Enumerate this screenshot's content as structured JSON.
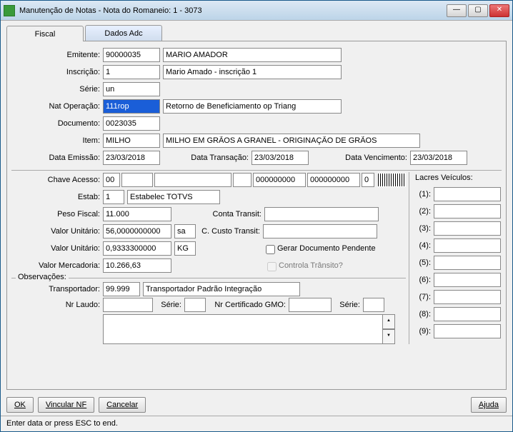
{
  "window": {
    "title": "Manutenção de Notas - Nota do Romaneio: 1 - 3073"
  },
  "tabs": {
    "fiscal": "Fiscal",
    "dados_adc": "Dados Adc"
  },
  "labels": {
    "emitente": "Emitente:",
    "inscricao": "Inscrição:",
    "serie": "Série:",
    "nat_operacao": "Nat Operação:",
    "documento": "Documento:",
    "item": "Item:",
    "data_emissao": "Data Emissão:",
    "data_transacao": "Data Transação:",
    "data_vencimento": "Data Vencimento:",
    "chave_acesso": "Chave Acesso:",
    "estab": "Estab:",
    "peso_fiscal": "Peso Fiscal:",
    "conta_transit": "Conta Transit:",
    "valor_unitario": "Valor Unitário:",
    "c_custo_transit": "C. Custo Transit:",
    "valor_mercadoria": "Valor Mercadoria:",
    "gerar_doc_pendente": "Gerar Documento Pendente",
    "controla_transito": "Controla Trânsito?",
    "observacoes": "Observações:",
    "transportador": "Transportador:",
    "nr_laudo": "Nr Laudo:",
    "serie2": "Série:",
    "nr_cert_gmo": "Nr Certificado GMO:",
    "serie3": "Série:",
    "lacres_veiculos": "Lacres Veículos:"
  },
  "values": {
    "emitente_cod": "90000035",
    "emitente_nome": "MARIO AMADOR",
    "inscricao_cod": "1",
    "inscricao_desc": "Mario Amado - inscrição 1",
    "serie": "un",
    "nat_operacao_cod": "111rop",
    "nat_operacao_desc": "Retorno de Beneficiamento op Triang",
    "documento": "0023035",
    "item_cod": "MILHO",
    "item_desc": "MILHO EM GRÃOS A GRANEL - ORIGINAÇÃO DE GRÃOS",
    "data_emissao": "23/03/2018",
    "data_transacao": "23/03/2018",
    "data_vencimento": "23/03/2018",
    "chave_acesso_1": "00",
    "chave_acesso_2": "",
    "chave_acesso_3": "",
    "chave_acesso_4": "",
    "chave_acesso_5": "000000000",
    "chave_acesso_6": "000000000",
    "chave_acesso_7": "0",
    "estab_cod": "1",
    "estab_desc": "Estabelec TOTVS",
    "peso_fiscal": "11.000",
    "conta_transit": "",
    "valor_unit1": "56,0000000000",
    "valor_unit1_un": "sa",
    "c_custo_transit": "",
    "valor_unit2": "0,9333300000",
    "valor_unit2_un": "KG",
    "valor_mercadoria": "10.266,63",
    "gerar_doc_pendente": false,
    "controla_transito": false,
    "transportador_cod": "99.999",
    "transportador_desc": "Transportador Padrão Integração",
    "nr_laudo": "",
    "serie2": "",
    "nr_cert_gmo": "",
    "serie3": "",
    "obs": "",
    "lacres": [
      "",
      "",
      "",
      "",
      "",
      "",
      "",
      "",
      ""
    ]
  },
  "lacre_labels": [
    "(1):",
    "(2):",
    "(3):",
    "(4):",
    "(5):",
    "(6):",
    "(7):",
    "(8):",
    "(9):"
  ],
  "buttons": {
    "ok": "OK",
    "vincular_nf": "Vincular NF",
    "cancelar": "Cancelar",
    "ajuda": "Ajuda"
  },
  "status": "Enter data or press ESC to end."
}
